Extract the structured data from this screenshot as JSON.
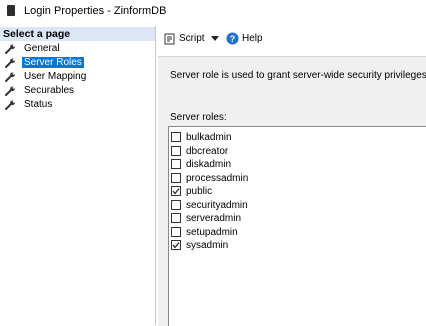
{
  "window": {
    "title": "Login Properties - ZinformDB"
  },
  "left": {
    "header": "Select a page",
    "pages": [
      {
        "label": "General",
        "selected": false
      },
      {
        "label": "Server Roles",
        "selected": true
      },
      {
        "label": "User Mapping",
        "selected": false
      },
      {
        "label": "Securables",
        "selected": false
      },
      {
        "label": "Status",
        "selected": false
      }
    ]
  },
  "toolbar": {
    "script_label": "Script",
    "help_label": "Help"
  },
  "main": {
    "description": "Server role is used to grant server-wide security privileges to a",
    "roles_label": "Server roles:",
    "roles": [
      {
        "name": "bulkadmin",
        "checked": false
      },
      {
        "name": "dbcreator",
        "checked": false
      },
      {
        "name": "diskadmin",
        "checked": false
      },
      {
        "name": "processadmin",
        "checked": false
      },
      {
        "name": "public",
        "checked": true
      },
      {
        "name": "securityadmin",
        "checked": false
      },
      {
        "name": "serveradmin",
        "checked": false
      },
      {
        "name": "setupadmin",
        "checked": false
      },
      {
        "name": "sysadmin",
        "checked": true
      }
    ]
  },
  "colors": {
    "selection": "#0078d7",
    "header_bg": "#dce6f4",
    "help_icon": "#1e73c8"
  }
}
